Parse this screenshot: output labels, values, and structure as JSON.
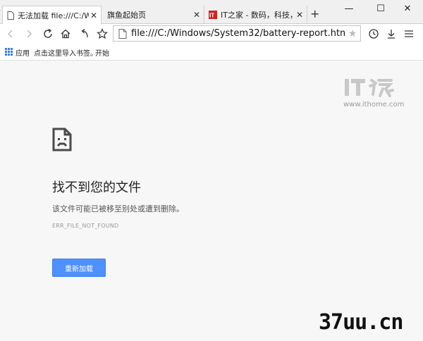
{
  "tabs": [
    {
      "label": "无法加载 file:///C:/Windows",
      "active": true,
      "favicon": "page-icon"
    },
    {
      "label": "旗鱼起始页",
      "active": false,
      "favicon": "none"
    },
    {
      "label": "IT之家 - 数码，科技，生活",
      "active": false,
      "favicon": "ithome-icon"
    }
  ],
  "window_controls": {
    "minimize": "—",
    "maximize": "☐",
    "close": "✕"
  },
  "toolbar": {
    "url": "file:///C:/Windows/System32/battery-report.html"
  },
  "bookmarks": {
    "apps_label": "应用",
    "import_label": "点击这里导入书签。",
    "start_label": "开始"
  },
  "error": {
    "title": "找不到您的文件",
    "description": "该文件可能已被移至别处或遭到删除。",
    "code": "ERR_FILE_NOT_FOUND",
    "reload_label": "重新加载"
  },
  "watermark": {
    "logo_text": "IT之家",
    "url": "www.ithome.com",
    "site": "37uu.cn"
  },
  "colors": {
    "accent": "#4d90fe",
    "ithome_red": "#d22222"
  }
}
